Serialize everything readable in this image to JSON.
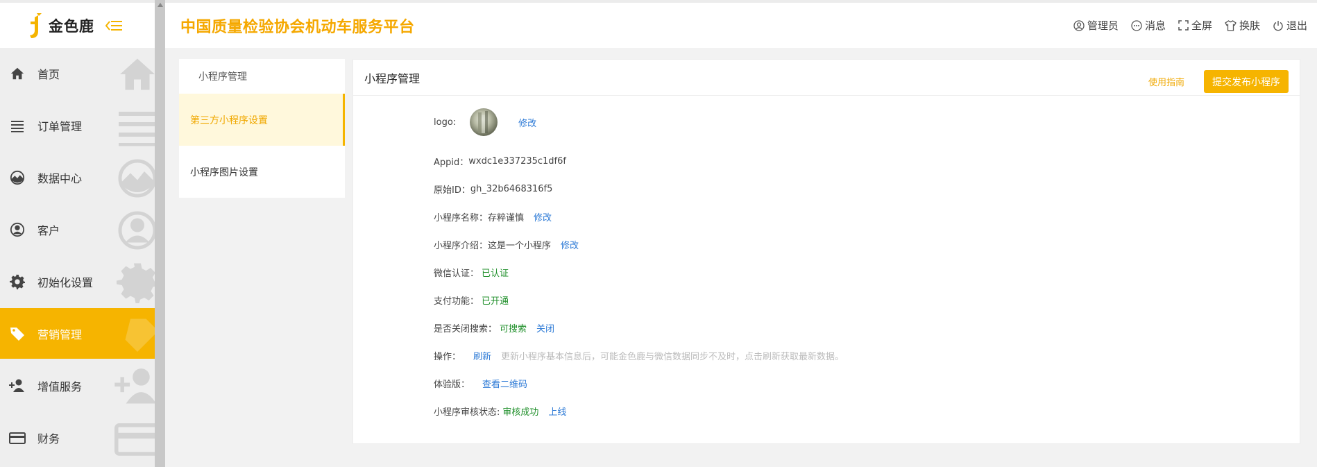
{
  "brand": {
    "name": "金色鹿",
    "accent": "#f6b400"
  },
  "sidebar": {
    "items": [
      {
        "label": "首页",
        "icon": "home-icon"
      },
      {
        "label": "订单管理",
        "icon": "list-icon"
      },
      {
        "label": "数据中心",
        "icon": "chart-icon"
      },
      {
        "label": "客户",
        "icon": "user-icon"
      },
      {
        "label": "初始化设置",
        "icon": "gear-icon"
      },
      {
        "label": "营销管理",
        "icon": "tag-icon",
        "active": true
      },
      {
        "label": "增值服务",
        "icon": "add-user-icon"
      },
      {
        "label": "财务",
        "icon": "card-icon"
      }
    ]
  },
  "header": {
    "title": "中国质量检验协会机动车服务平台",
    "actions": {
      "admin": "管理员",
      "messages": "消息",
      "fullscreen": "全屏",
      "skin": "换肤",
      "logout": "退出"
    }
  },
  "submenu": {
    "title": "小程序管理",
    "items": [
      {
        "label": "第三方小程序设置",
        "active": true
      },
      {
        "label": "小程序图片设置"
      }
    ]
  },
  "panel": {
    "title": "小程序管理",
    "guide_link": "使用指南",
    "publish_button": "提交发布小程序",
    "logo_label": "logo:",
    "logo_edit": "修改",
    "appid_label": "Appid：",
    "appid_value": "wxdc1e337235c1df6f",
    "origin_label": "原始ID：",
    "origin_value": "gh_32b6468316f5",
    "name_label": "小程序名称：",
    "name_value": "存粹谨慎",
    "name_edit": "修改",
    "intro_label": "小程序介绍：",
    "intro_value": "这是一个小程序",
    "intro_edit": "修改",
    "wechat_label": "微信认证：",
    "wechat_value": "已认证",
    "pay_label": "支付功能：",
    "pay_value": "已开通",
    "search_label": "是否关闭搜索：",
    "search_value": "可搜索",
    "search_action": "关闭",
    "op_label": "操作：",
    "op_action": "刷新",
    "op_hint": "更新小程序基本信息后，可能金色鹿与微信数据同步不及时，点击刷新获取最新数据。",
    "trial_label": "体验版：",
    "trial_action": "查看二维码",
    "audit_label": "小程序审核状态:",
    "audit_value": "审核成功",
    "audit_action": "上线"
  }
}
